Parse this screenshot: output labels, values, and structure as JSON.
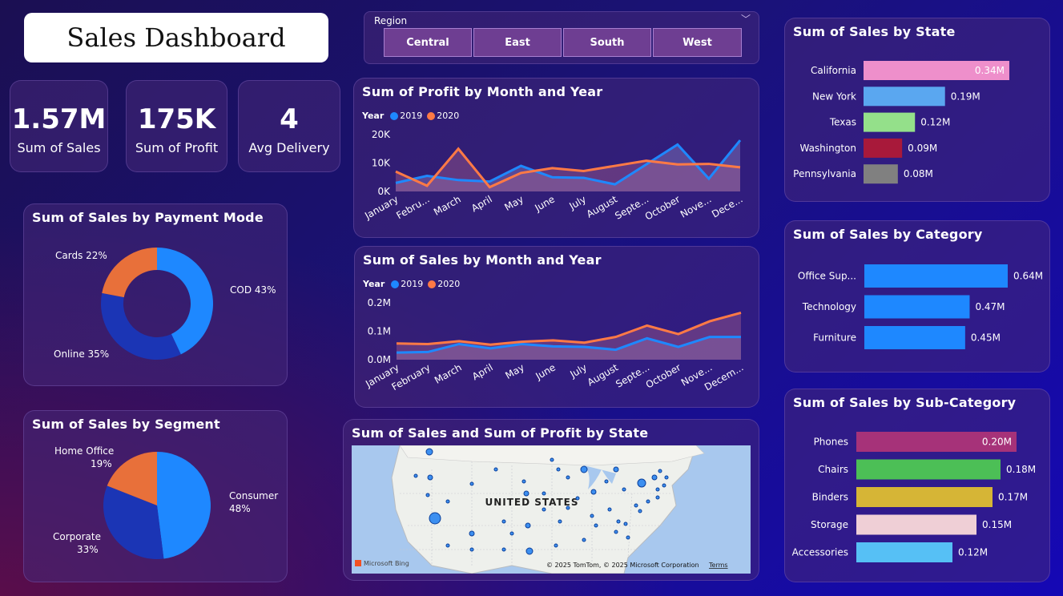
{
  "header": {
    "title": "Sales Dashboard"
  },
  "kpis": [
    {
      "value": "1.57M",
      "label": "Sum of Sales"
    },
    {
      "value": "175K",
      "label": "Sum of Profit"
    },
    {
      "value": "4",
      "label": "Avg Delivery"
    }
  ],
  "slicer": {
    "label": "Region",
    "options": [
      "Central",
      "East",
      "South",
      "West"
    ]
  },
  "colors": {
    "y2019": "#1e88ff",
    "y2020": "#ff7a45",
    "donut_cod": "#1e88ff",
    "donut_online": "#1b35b5",
    "donut_cards": "#e8703a"
  },
  "charts": {
    "profit": {
      "title": "Sum of Profit by Month and Year",
      "legend_title": "Year",
      "legend": [
        "2019",
        "2020"
      ],
      "yticks": [
        "20K",
        "10K",
        "0K"
      ],
      "months": [
        "January",
        "Febru...",
        "March",
        "April",
        "May",
        "June",
        "July",
        "August",
        "Septe...",
        "October",
        "Nove...",
        "Dece..."
      ]
    },
    "sales": {
      "title": "Sum of Sales by Month and Year",
      "legend_title": "Year",
      "legend": [
        "2019",
        "2020"
      ],
      "yticks": [
        "0.2M",
        "0.1M",
        "0.0M"
      ],
      "months": [
        "January",
        "February",
        "March",
        "April",
        "May",
        "June",
        "July",
        "August",
        "Septe...",
        "October",
        "Nove...",
        "Decem..."
      ]
    },
    "payment": {
      "title": "Sum of Sales by Payment Mode",
      "labels": [
        "COD 43%",
        "Online 35%",
        "Cards 22%"
      ]
    },
    "segment": {
      "title": "Sum of Sales by Segment",
      "labels": {
        "consumer_name": "Consumer",
        "consumer_pct": "48%",
        "corporate_name": "Corporate",
        "corporate_pct": "33%",
        "home_name": "Home Office",
        "home_pct": "19%"
      }
    },
    "state": {
      "title": "Sum of Sales by State"
    },
    "category": {
      "title": "Sum of Sales by Category"
    },
    "subcategory": {
      "title": "Sum of Sales by Sub-Category"
    },
    "map": {
      "title": "Sum of Sales and Sum of Profit by State",
      "country_label": "UNITED STATES",
      "attribution": "© 2025 TomTom, © 2025 Microsoft Corporation",
      "terms": "Terms",
      "brand": "Microsoft Bing"
    }
  },
  "chart_data": [
    {
      "type": "line",
      "title": "Sum of Profit by Month and Year",
      "x": [
        "January",
        "February",
        "March",
        "April",
        "May",
        "June",
        "July",
        "August",
        "September",
        "October",
        "November",
        "December"
      ],
      "ylim": [
        0,
        20000
      ],
      "series": [
        {
          "name": "2019",
          "values": [
            3000,
            5500,
            4000,
            3500,
            9000,
            5000,
            4800,
            2500,
            9500,
            16500,
            4500,
            18000
          ]
        },
        {
          "name": "2020",
          "values": [
            7000,
            2000,
            15000,
            1500,
            6500,
            8200,
            7200,
            9000,
            10800,
            9500,
            9700,
            8500
          ]
        }
      ]
    },
    {
      "type": "line",
      "title": "Sum of Sales by Month and Year",
      "x": [
        "January",
        "February",
        "March",
        "April",
        "May",
        "June",
        "July",
        "August",
        "September",
        "October",
        "November",
        "December"
      ],
      "ylim": [
        0,
        0.2
      ],
      "series": [
        {
          "name": "2019",
          "values": [
            0.025,
            0.027,
            0.055,
            0.04,
            0.055,
            0.047,
            0.045,
            0.035,
            0.075,
            0.045,
            0.08,
            0.08
          ]
        },
        {
          "name": "2020",
          "values": [
            0.057,
            0.055,
            0.065,
            0.053,
            0.063,
            0.068,
            0.06,
            0.08,
            0.12,
            0.09,
            0.135,
            0.165
          ]
        }
      ]
    },
    {
      "type": "pie",
      "title": "Sum of Sales by Payment Mode",
      "categories": [
        "COD",
        "Online",
        "Cards"
      ],
      "values": [
        43,
        35,
        22
      ]
    },
    {
      "type": "pie",
      "title": "Sum of Sales by Segment",
      "categories": [
        "Consumer",
        "Corporate",
        "Home Office"
      ],
      "values": [
        48,
        33,
        19
      ]
    },
    {
      "type": "bar",
      "title": "Sum of Sales by State",
      "categories": [
        "California",
        "New York",
        "Texas",
        "Washington",
        "Pennsylvania"
      ],
      "values": [
        0.34,
        0.19,
        0.12,
        0.09,
        0.08
      ],
      "labels": [
        "0.34M",
        "0.19M",
        "0.12M",
        "0.09M",
        "0.08M"
      ],
      "colors": [
        "#ee8fcb",
        "#5aa7f0",
        "#94e08a",
        "#a8193a",
        "#808080"
      ]
    },
    {
      "type": "bar",
      "title": "Sum of Sales by Category",
      "categories": [
        "Office Sup...",
        "Technology",
        "Furniture"
      ],
      "values": [
        0.64,
        0.47,
        0.45
      ],
      "labels": [
        "0.64M",
        "0.47M",
        "0.45M"
      ],
      "colors": [
        "#1e88ff",
        "#1e88ff",
        "#1e88ff"
      ]
    },
    {
      "type": "bar",
      "title": "Sum of Sales by Sub-Category",
      "categories": [
        "Phones",
        "Chairs",
        "Binders",
        "Storage",
        "Accessories"
      ],
      "values": [
        0.2,
        0.18,
        0.17,
        0.15,
        0.12
      ],
      "labels": [
        "0.20M",
        "0.18M",
        "0.17M",
        "0.15M",
        "0.12M"
      ],
      "colors": [
        "#a63279",
        "#4cbf56",
        "#d6b536",
        "#efcfd6",
        "#56c0f5"
      ]
    }
  ]
}
